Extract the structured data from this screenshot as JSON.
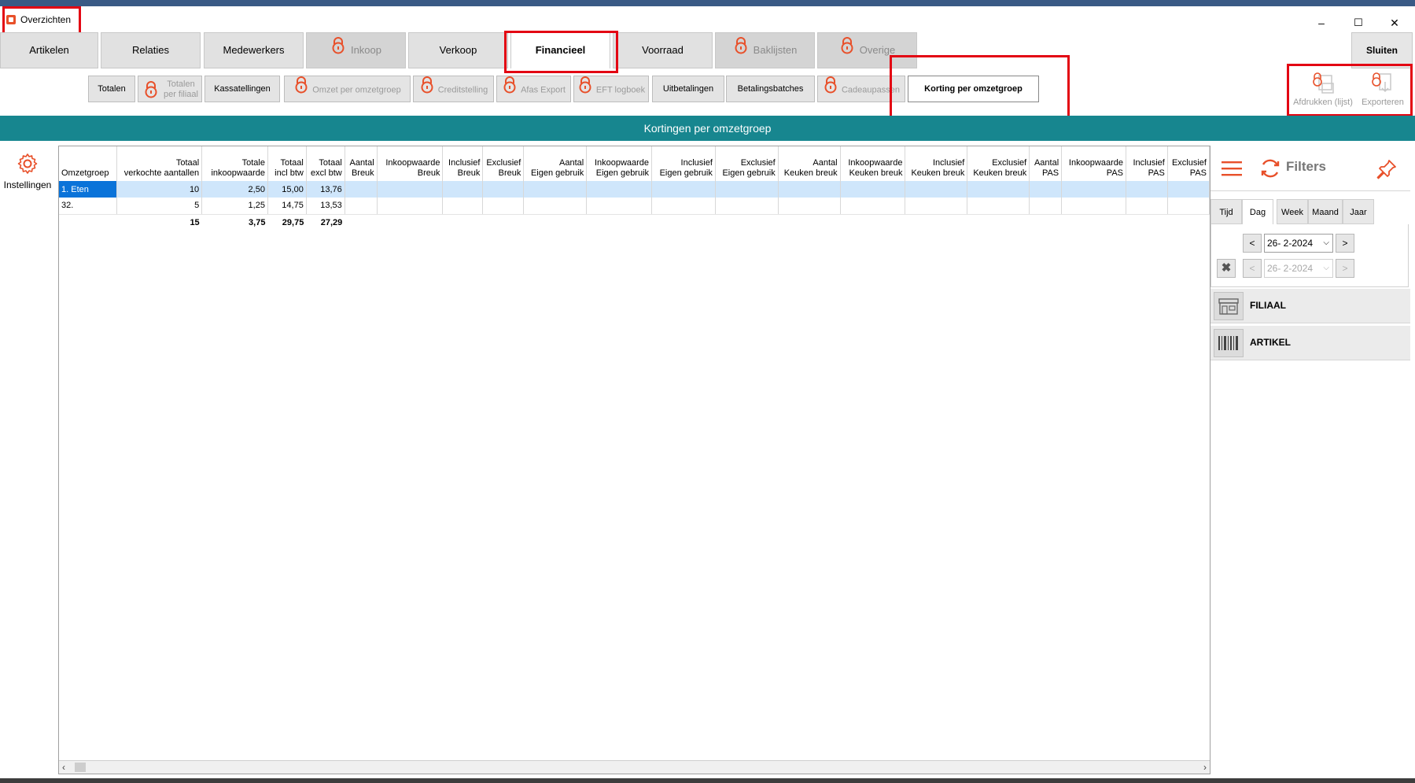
{
  "window": {
    "title": "Overzichten",
    "minimize": "–",
    "maximize": "☐",
    "close": "✕"
  },
  "main_tabs": [
    {
      "label": "Artikelen",
      "locked": false
    },
    {
      "label": "Relaties",
      "locked": false
    },
    {
      "label": "Medewerkers",
      "locked": false
    },
    {
      "label": "Inkoop",
      "locked": true
    },
    {
      "label": "Verkoop",
      "locked": false
    },
    {
      "label": "Financieel",
      "locked": false,
      "active": true
    },
    {
      "label": "Voorraad",
      "locked": false
    },
    {
      "label": "Baklijsten",
      "locked": true
    },
    {
      "label": "Overige",
      "locked": true
    }
  ],
  "close_button": "Sluiten",
  "sub_tabs": [
    {
      "label": "Totalen",
      "locked": false
    },
    {
      "label": "Totalen per filiaal",
      "line1": "Totalen",
      "line2": "per filiaal",
      "locked": true
    },
    {
      "label": "Kassatellingen",
      "locked": false
    },
    {
      "label": "Omzet per omzetgroep",
      "locked": true
    },
    {
      "label": "Creditstelling",
      "locked": true
    },
    {
      "label": "Afas Export",
      "locked": true
    },
    {
      "label": "EFT logboek",
      "locked": true
    },
    {
      "label": "Uitbetalingen",
      "locked": false
    },
    {
      "label": "Betalingsbatches",
      "locked": false
    },
    {
      "label": "Cadeaupassen",
      "locked": true
    },
    {
      "label": "Korting per omzetgroep",
      "locked": false,
      "active": true
    }
  ],
  "tools": {
    "print": "Afdrukken (lijst)",
    "export": "Exporteren"
  },
  "banner_title": "Kortingen per omzetgroep",
  "settings_label": "Instellingen",
  "grid": {
    "columns": [
      {
        "l1": "",
        "l2": "Omzetgroep"
      },
      {
        "l1": "Totaal",
        "l2": "verkochte aantallen"
      },
      {
        "l1": "Totale",
        "l2": "inkoopwaarde"
      },
      {
        "l1": "Totaal",
        "l2": "incl btw"
      },
      {
        "l1": "Totaal",
        "l2": "excl btw"
      },
      {
        "l1": "Aantal",
        "l2": "Breuk"
      },
      {
        "l1": "Inkoopwaarde",
        "l2": "Breuk"
      },
      {
        "l1": "Inclusief",
        "l2": "Breuk"
      },
      {
        "l1": "Exclusief",
        "l2": "Breuk"
      },
      {
        "l1": "Aantal",
        "l2": "Eigen gebruik"
      },
      {
        "l1": "Inkoopwaarde",
        "l2": "Eigen gebruik"
      },
      {
        "l1": "Inclusief",
        "l2": "Eigen gebruik"
      },
      {
        "l1": "Exclusief",
        "l2": "Eigen gebruik"
      },
      {
        "l1": "Aantal",
        "l2": "Keuken breuk"
      },
      {
        "l1": "Inkoopwaarde",
        "l2": "Keuken breuk"
      },
      {
        "l1": "Inclusief",
        "l2": "Keuken breuk"
      },
      {
        "l1": "Exclusief",
        "l2": "Keuken breuk"
      },
      {
        "l1": "Aantal",
        "l2": "PAS"
      },
      {
        "l1": "Inkoopwaarde",
        "l2": "PAS"
      },
      {
        "l1": "Inclusief",
        "l2": "PAS"
      },
      {
        "l1": "Exclusief",
        "l2": "PAS"
      }
    ],
    "rows": [
      {
        "omzetgroep": "1. Eten",
        "aantal": "10",
        "inkoop": "2,50",
        "incl": "15,00",
        "excl": "13,76"
      },
      {
        "omzetgroep": "32.",
        "aantal": "5",
        "inkoop": "1,25",
        "incl": "14,75",
        "excl": "13,53"
      }
    ],
    "totals": {
      "aantal": "15",
      "inkoop": "3,75",
      "incl": "29,75",
      "excl": "27,29"
    }
  },
  "filters": {
    "title": "Filters",
    "period_tabs": [
      "Tijd",
      "Dag",
      "Week",
      "Maand",
      "Jaar"
    ],
    "active_period": "Dag",
    "date_from": "26-  2-2024",
    "date_to": "26-  2-2024",
    "prev": "<",
    "next": ">",
    "groups": [
      "FILIAAL",
      "ARTIKEL"
    ]
  },
  "colors": {
    "accent": "#e8502a",
    "banner": "#17868f",
    "selection": "#0a73d9",
    "highlight_box": "#e30613"
  }
}
